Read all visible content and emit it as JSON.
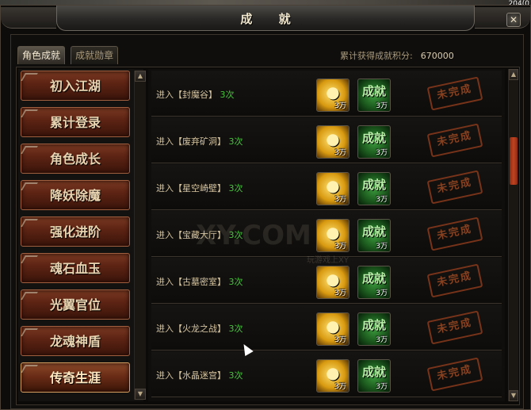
{
  "window": {
    "title": "成 就",
    "corner_text": "204(0"
  },
  "tabs": [
    {
      "label": "角色成就",
      "active": true
    },
    {
      "label": "成就勋章",
      "active": false
    }
  ],
  "score": {
    "label": "累计获得成就积分:",
    "value": "670000"
  },
  "categories": [
    {
      "label": "初入江湖"
    },
    {
      "label": "累计登录"
    },
    {
      "label": "角色成长"
    },
    {
      "label": "降妖除魔"
    },
    {
      "label": "强化进阶"
    },
    {
      "label": "魂石血玉"
    },
    {
      "label": "光翼官位"
    },
    {
      "label": "龙魂神盾"
    },
    {
      "label": "传奇生涯",
      "active": true
    }
  ],
  "achievements": [
    {
      "prefix": "进入【",
      "place": "封魔谷",
      "suffix": "】",
      "count": "3次",
      "gold": "3万",
      "score_label": "成就",
      "score": "3万",
      "status": "未完成"
    },
    {
      "prefix": "进入【",
      "place": "废弃矿洞",
      "suffix": "】",
      "count": "3次",
      "gold": "3万",
      "score_label": "成就",
      "score": "3万",
      "status": "未完成"
    },
    {
      "prefix": "进入【",
      "place": "星空崎壁",
      "suffix": "】",
      "count": "3次",
      "gold": "3万",
      "score_label": "成就",
      "score": "3万",
      "status": "未完成"
    },
    {
      "prefix": "进入【",
      "place": "宝藏大厅",
      "suffix": "】",
      "count": "3次",
      "gold": "3万",
      "score_label": "成就",
      "score": "3万",
      "status": "未完成"
    },
    {
      "prefix": "进入【",
      "place": "古墓密室",
      "suffix": "】",
      "count": "3次",
      "gold": "3万",
      "score_label": "成就",
      "score": "3万",
      "status": "未完成"
    },
    {
      "prefix": "进入【",
      "place": "火龙之战",
      "suffix": "】",
      "count": "3次",
      "gold": "3万",
      "score_label": "成就",
      "score": "3万",
      "status": "未完成"
    },
    {
      "prefix": "进入【",
      "place": "水晶迷宫",
      "suffix": "】",
      "count": "3次",
      "gold": "3万",
      "score_label": "成就",
      "score": "3万",
      "status": "未完成"
    }
  ],
  "watermark": {
    "main": "XY.COM",
    "sub": "玩游戏上XY"
  },
  "icons": {
    "close": "close-icon",
    "scroll_up": "arrow-up-icon",
    "scroll_down": "arrow-down-icon",
    "gold": "gold-coin-icon",
    "achievement": "achievement-points-icon"
  },
  "colors": {
    "count_green": "#46c43c",
    "stamp_red": "#9a4a24",
    "category_red": "#5e2414"
  }
}
